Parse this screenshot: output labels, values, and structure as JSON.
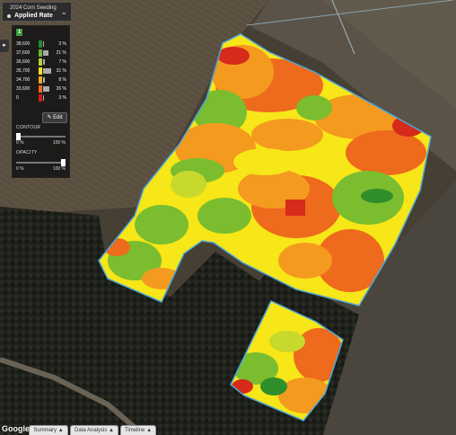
{
  "layer_selector": {
    "title": "2024 Corn Seeding",
    "subtitle": "Applied Rate",
    "chevron": "chevron-down-icon"
  },
  "panel": {
    "badge": "1",
    "collapse_icon": "collapse-arrow-icon",
    "legend": [
      {
        "value": "38,600",
        "percent": "3 %",
        "color": "#1f8a2e",
        "share": 0.03
      },
      {
        "value": "37,600",
        "percent": "21 %",
        "color": "#6bb83a",
        "share": 0.21
      },
      {
        "value": "36,600",
        "percent": "7 %",
        "color": "#b8d43a",
        "share": 0.07
      },
      {
        "value": "35,700",
        "percent": "31 %",
        "color": "#f5e31c",
        "share": 0.31
      },
      {
        "value": "34,700",
        "percent": "8 %",
        "color": "#f6a623",
        "share": 0.08
      },
      {
        "value": "33,600",
        "percent": "26 %",
        "color": "#ee6a1c",
        "share": 0.26
      },
      {
        "value": "0",
        "percent": "3 %",
        "color": "#d61b1b",
        "share": 0.03
      }
    ],
    "edit_label": "Edit",
    "contour": {
      "label": "CONTOUR",
      "min": "0 %",
      "max": "100 %",
      "level": 0.0
    },
    "opacity": {
      "label": "OPACITY",
      "min": "0 %",
      "max": "100 %",
      "level": 1.0
    }
  },
  "footer": {
    "google": "Google",
    "tabs": [
      "Summary ▲",
      "Data Analysis ▲",
      "Timeline ▲"
    ]
  },
  "colors": {
    "green_dark": "#2f8f2a",
    "green": "#7bbd2e",
    "yellow_green": "#c7d92c",
    "yellow": "#f7e618",
    "orange": "#f49a1f",
    "orange_red": "#ee6a1c",
    "red": "#d62a1a",
    "field_outline": "#4aa8d8"
  }
}
